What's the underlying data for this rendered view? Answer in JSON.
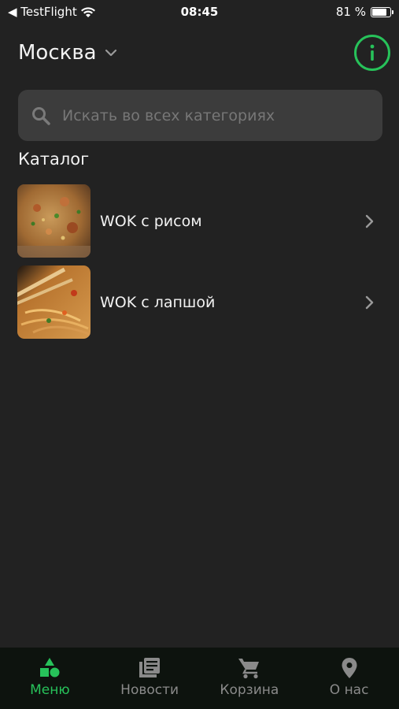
{
  "status_bar": {
    "back_label": "◀ TestFlight",
    "time": "08:45",
    "battery_text": "81 %",
    "battery_level": 0.81
  },
  "header": {
    "city": "Москва"
  },
  "search": {
    "placeholder": "Искать во всех категориях"
  },
  "catalog": {
    "title": "Каталог",
    "items": [
      {
        "label": "WOK с рисом"
      },
      {
        "label": "WOK с лапшой"
      }
    ]
  },
  "tabs": [
    {
      "label": "Меню",
      "icon": "shapes-icon",
      "active": true
    },
    {
      "label": "Новости",
      "icon": "news-icon",
      "active": false
    },
    {
      "label": "Корзина",
      "icon": "cart-icon",
      "active": false
    },
    {
      "label": "О нас",
      "icon": "location-pin-icon",
      "active": false
    }
  ],
  "colors": {
    "accent": "#27c25a",
    "background": "#222222",
    "tabbar": "#0d130e"
  }
}
